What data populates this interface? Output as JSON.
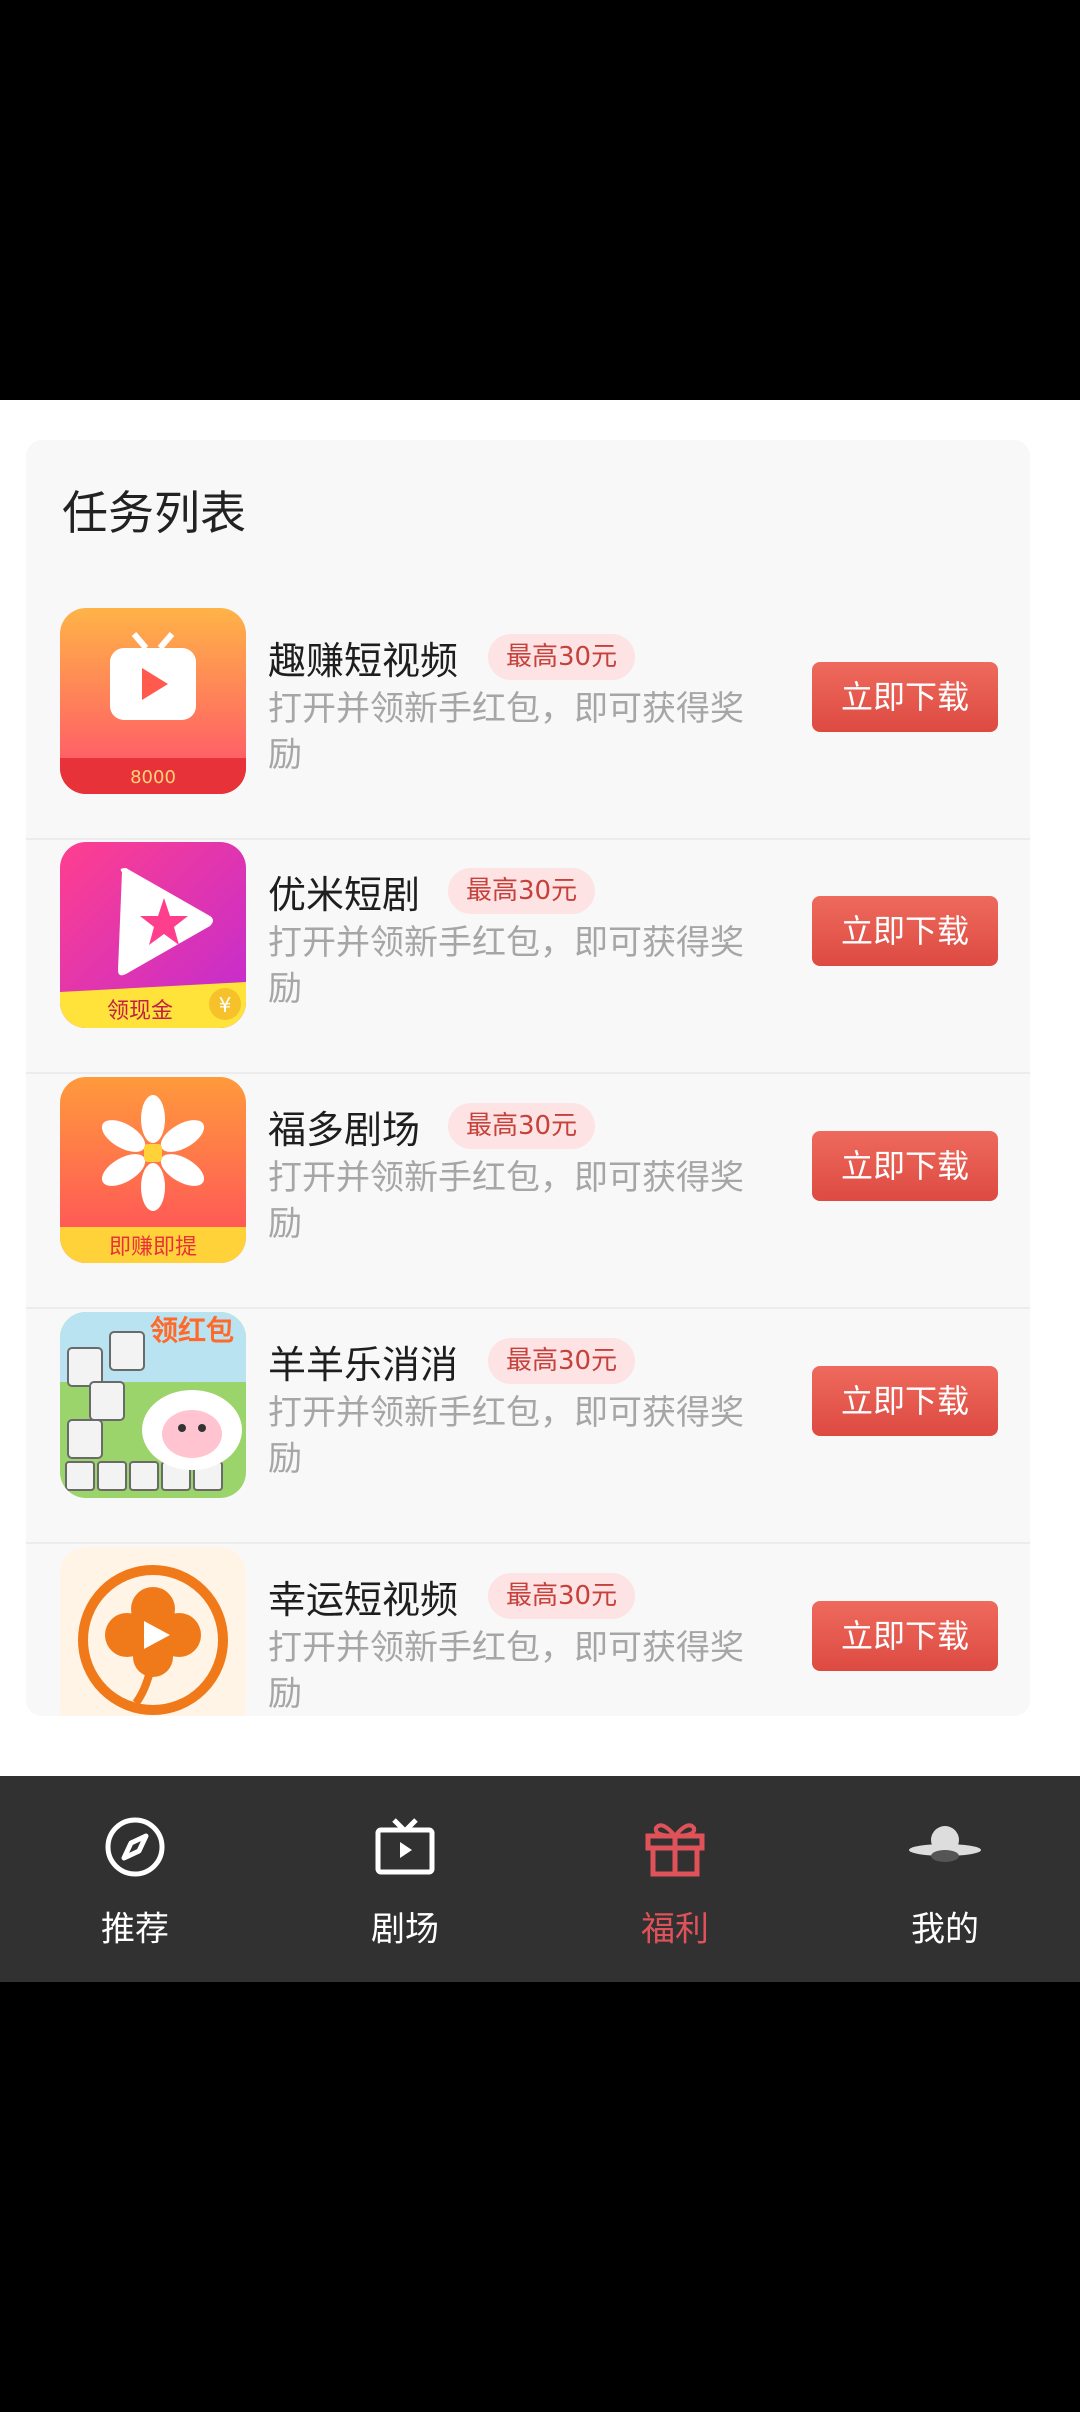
{
  "card": {
    "title": "任务列表"
  },
  "tasks": [
    {
      "name": "趣赚短视频",
      "badge": "最高30元",
      "desc": "打开并领新手红包，即可获得奖励",
      "button": "立即下载",
      "icon": "quzhuan-app-icon",
      "icon_caption": "8000"
    },
    {
      "name": "优米短剧",
      "badge": "最高30元",
      "desc": "打开并领新手红包，即可获得奖励",
      "button": "立即下载",
      "icon": "youmi-app-icon",
      "icon_caption": "领现金"
    },
    {
      "name": "福多剧场",
      "badge": "最高30元",
      "desc": "打开并领新手红包，即可获得奖励",
      "button": "立即下载",
      "icon": "fuduo-app-icon",
      "icon_caption": "即赚即提"
    },
    {
      "name": "羊羊乐消消",
      "badge": "最高30元",
      "desc": "打开并领新手红包，即可获得奖励",
      "button": "立即下载",
      "icon": "yangyang-app-icon",
      "icon_caption": "领红包"
    },
    {
      "name": "幸运短视频",
      "badge": "最高30元",
      "desc": "打开并领新手红包，即可获得奖励",
      "button": "立即下载",
      "icon": "xingyun-app-icon"
    }
  ],
  "tabs": [
    {
      "label": "推荐",
      "icon": "compass-icon",
      "active": false
    },
    {
      "label": "剧场",
      "icon": "tv-icon",
      "active": false
    },
    {
      "label": "福利",
      "icon": "gift-icon",
      "active": true
    },
    {
      "label": "我的",
      "icon": "user-avatar-icon",
      "active": false
    }
  ],
  "colors": {
    "accent": "#e0525a",
    "button": "#e45a4e",
    "badge_bg": "#fde3e3",
    "tabbar_bg": "#313131"
  }
}
